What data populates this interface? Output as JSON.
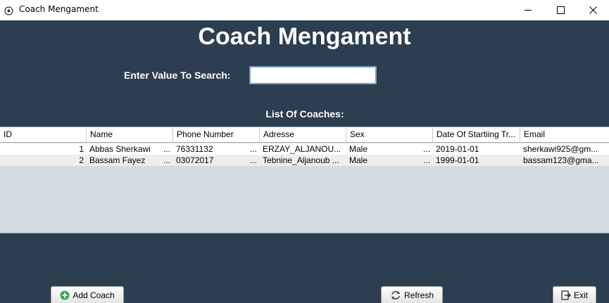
{
  "window": {
    "title": "Coach Mengament",
    "app_icon": "soccer-ball-icon",
    "controls": [
      "minimize-icon",
      "maximize-icon",
      "close-icon"
    ]
  },
  "header": {
    "title": "Coach Mengament"
  },
  "search": {
    "label": "Enter Value To Search:",
    "value": ""
  },
  "list": {
    "title": "List Of Coaches:",
    "columns": [
      "ID",
      "Name",
      "Phone Number",
      "Adresse",
      "Sex",
      "Date Of Startiing Tr...",
      "Email"
    ],
    "rows": [
      {
        "id": "1",
        "name": "Abbas Sherkawi",
        "phone": "76331132",
        "adresse": "ERZAY_ALJANOU...",
        "sex": "Male",
        "date": "2019-01-01",
        "email": "sherkawi925@gm..."
      },
      {
        "id": "2",
        "name": "Bassam Fayez",
        "phone": "03072017",
        "adresse": "Tebnine_Aljanoub ...",
        "sex": "Male",
        "date": "1999-01-01",
        "email": "bassam123@gma..."
      }
    ]
  },
  "buttons": {
    "add": "Add Coach",
    "refresh": "Refresh",
    "exit": "Exit"
  },
  "colors": {
    "background": "#2c3e50",
    "table_empty": "#d5dbe3",
    "add_icon": "#3aa655"
  }
}
